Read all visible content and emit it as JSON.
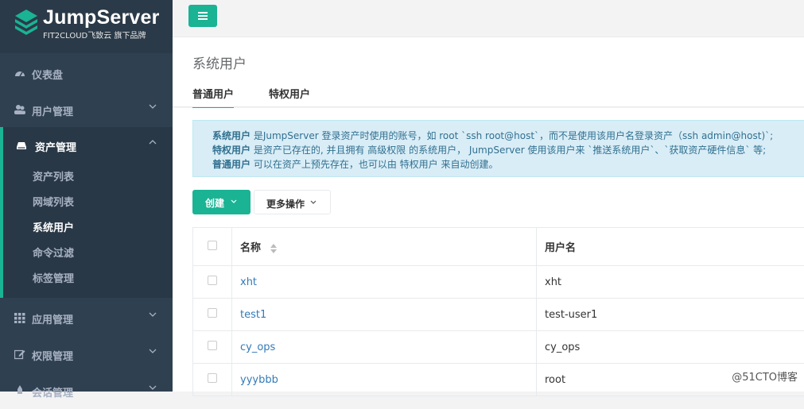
{
  "brand": {
    "title": "JumpServer",
    "subtitle": "FIT2CLOUD飞致云 旗下品牌"
  },
  "sidebar": {
    "items": [
      {
        "label": "仪表盘",
        "icon": "dashboard-icon"
      },
      {
        "label": "用户管理",
        "icon": "users-icon"
      },
      {
        "label": "资产管理",
        "icon": "hdd-icon"
      },
      {
        "label": "应用管理",
        "icon": "grid-icon"
      },
      {
        "label": "权限管理",
        "icon": "edit-icon"
      },
      {
        "label": "会话管理",
        "icon": "rocket-icon"
      }
    ],
    "sub_items": [
      "资产列表",
      "网域列表",
      "系统用户",
      "命令过滤",
      "标签管理"
    ],
    "current": "系统用户"
  },
  "header": {
    "menu_icon": "hamburger-icon"
  },
  "page": {
    "title": "系统用户",
    "tabs": [
      "普通用户",
      "特权用户"
    ],
    "active_tab": "普通用户"
  },
  "alert": {
    "line1_bold": "系统用户",
    "line1_text": " 是JumpServer 登录资产时使用的账号，如 root `ssh root@host`，而不是使用该用户名登录资产（ssh admin@host)`;",
    "line2_bold": "特权用户",
    "line2_text": " 是资产已存在的, 并且拥有 高级权限 的系统用户， JumpServer 使用该用户来 `推送系统用户`、`获取资产硬件信息` 等;",
    "line3_bold": "普通用户",
    "line3_text": " 可以在资产上预先存在，也可以由 特权用户 来自动创建。"
  },
  "toolbar": {
    "create_label": "创建",
    "more_label": "更多操作"
  },
  "table": {
    "headers": [
      "名称",
      "用户名"
    ],
    "rows": [
      {
        "name": "xht",
        "username": "xht"
      },
      {
        "name": "test1",
        "username": "test-user1"
      },
      {
        "name": "cy_ops",
        "username": "cy_ops"
      },
      {
        "name": "yyybbb",
        "username": "root"
      }
    ]
  },
  "watermark": "@51CTO博客",
  "colors": {
    "accent": "#1ab394",
    "sidebar": "#2f4050",
    "link": "#337ab7",
    "alert_bg": "#d9edf7"
  }
}
